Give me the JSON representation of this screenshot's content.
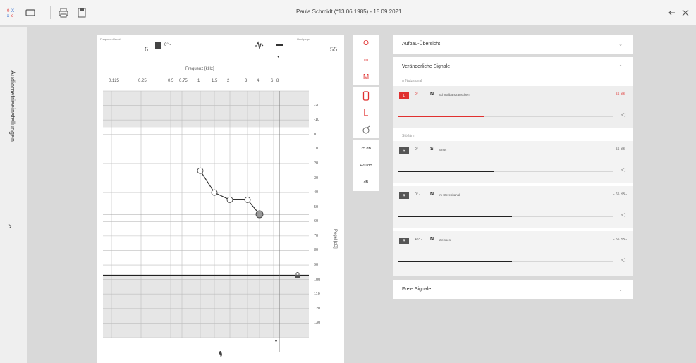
{
  "titlebar": {
    "title": "Paula Schmidt (*13.06.1985) - 15.09.2021",
    "icons": [
      "patient-icon",
      "window-icon",
      "print-icon",
      "save-icon",
      "back-arrow-icon",
      "close-icon"
    ]
  },
  "sidebar": {
    "label": "Audiometrieeinstellungen"
  },
  "audiogram": {
    "left_mini_label": "Frequenz-Kanal",
    "right_mini_label": "Hochpegel",
    "left_value": "6",
    "dropdown_value": "0° -",
    "right_value": "55",
    "frequency_title": "Frequenz [kHz]",
    "freq_ticks": [
      "0,125",
      "0,25",
      "0,5",
      "0,75",
      "1",
      "1,5",
      "2",
      "3",
      "4",
      "6",
      "8"
    ],
    "db_ticks": [
      "-20",
      "-10",
      "0",
      "10",
      "20",
      "30",
      "40",
      "50",
      "60",
      "70",
      "80",
      "90",
      "100",
      "110",
      "120",
      "130"
    ],
    "y_label": "Pegel [dB]",
    "points": [
      {
        "khz": 1,
        "db": 25
      },
      {
        "khz": 1.5,
        "db": 40
      },
      {
        "khz": 2,
        "db": 45
      },
      {
        "khz": 3,
        "db": 45
      },
      {
        "khz": 4,
        "db": 55
      }
    ],
    "colors": {
      "grid": "#bdbdbd",
      "shade": "#e6e6e6",
      "curve": "#333333"
    }
  },
  "tools": {
    "group1": [
      "O",
      "m",
      "M"
    ],
    "group3": [
      "25 dB",
      "+20 dB",
      "dB"
    ]
  },
  "right": {
    "overview_label": "Aufbau-Übersicht",
    "variable_label": "Veränderliche Signale",
    "useful_signal_label": "Nutzsignal",
    "noise_label": "Störlärm",
    "free_label": "Freie Signale",
    "signals": [
      {
        "badge": "L",
        "angle": "0° -",
        "type": "N",
        "name": "Schmalbandrauschen",
        "level": "- 55 dB -",
        "fill": 0.4,
        "active": true
      },
      {
        "badge": "R",
        "angle": "0° -",
        "type": "S",
        "name": "Sinus",
        "level": "- 55 dB -",
        "fill": 0.45,
        "active": false
      },
      {
        "badge": "R",
        "angle": "0° -",
        "type": "N",
        "name": "Im Stereokanal",
        "level": "- 65 dB -",
        "fill": 0.53,
        "active": false
      },
      {
        "badge": "R",
        "angle": "45° -",
        "type": "N",
        "name": "Weisses",
        "level": "- 55 dB -",
        "fill": 0.53,
        "active": false
      }
    ],
    "colors": {
      "accent": "#e0302f"
    }
  }
}
